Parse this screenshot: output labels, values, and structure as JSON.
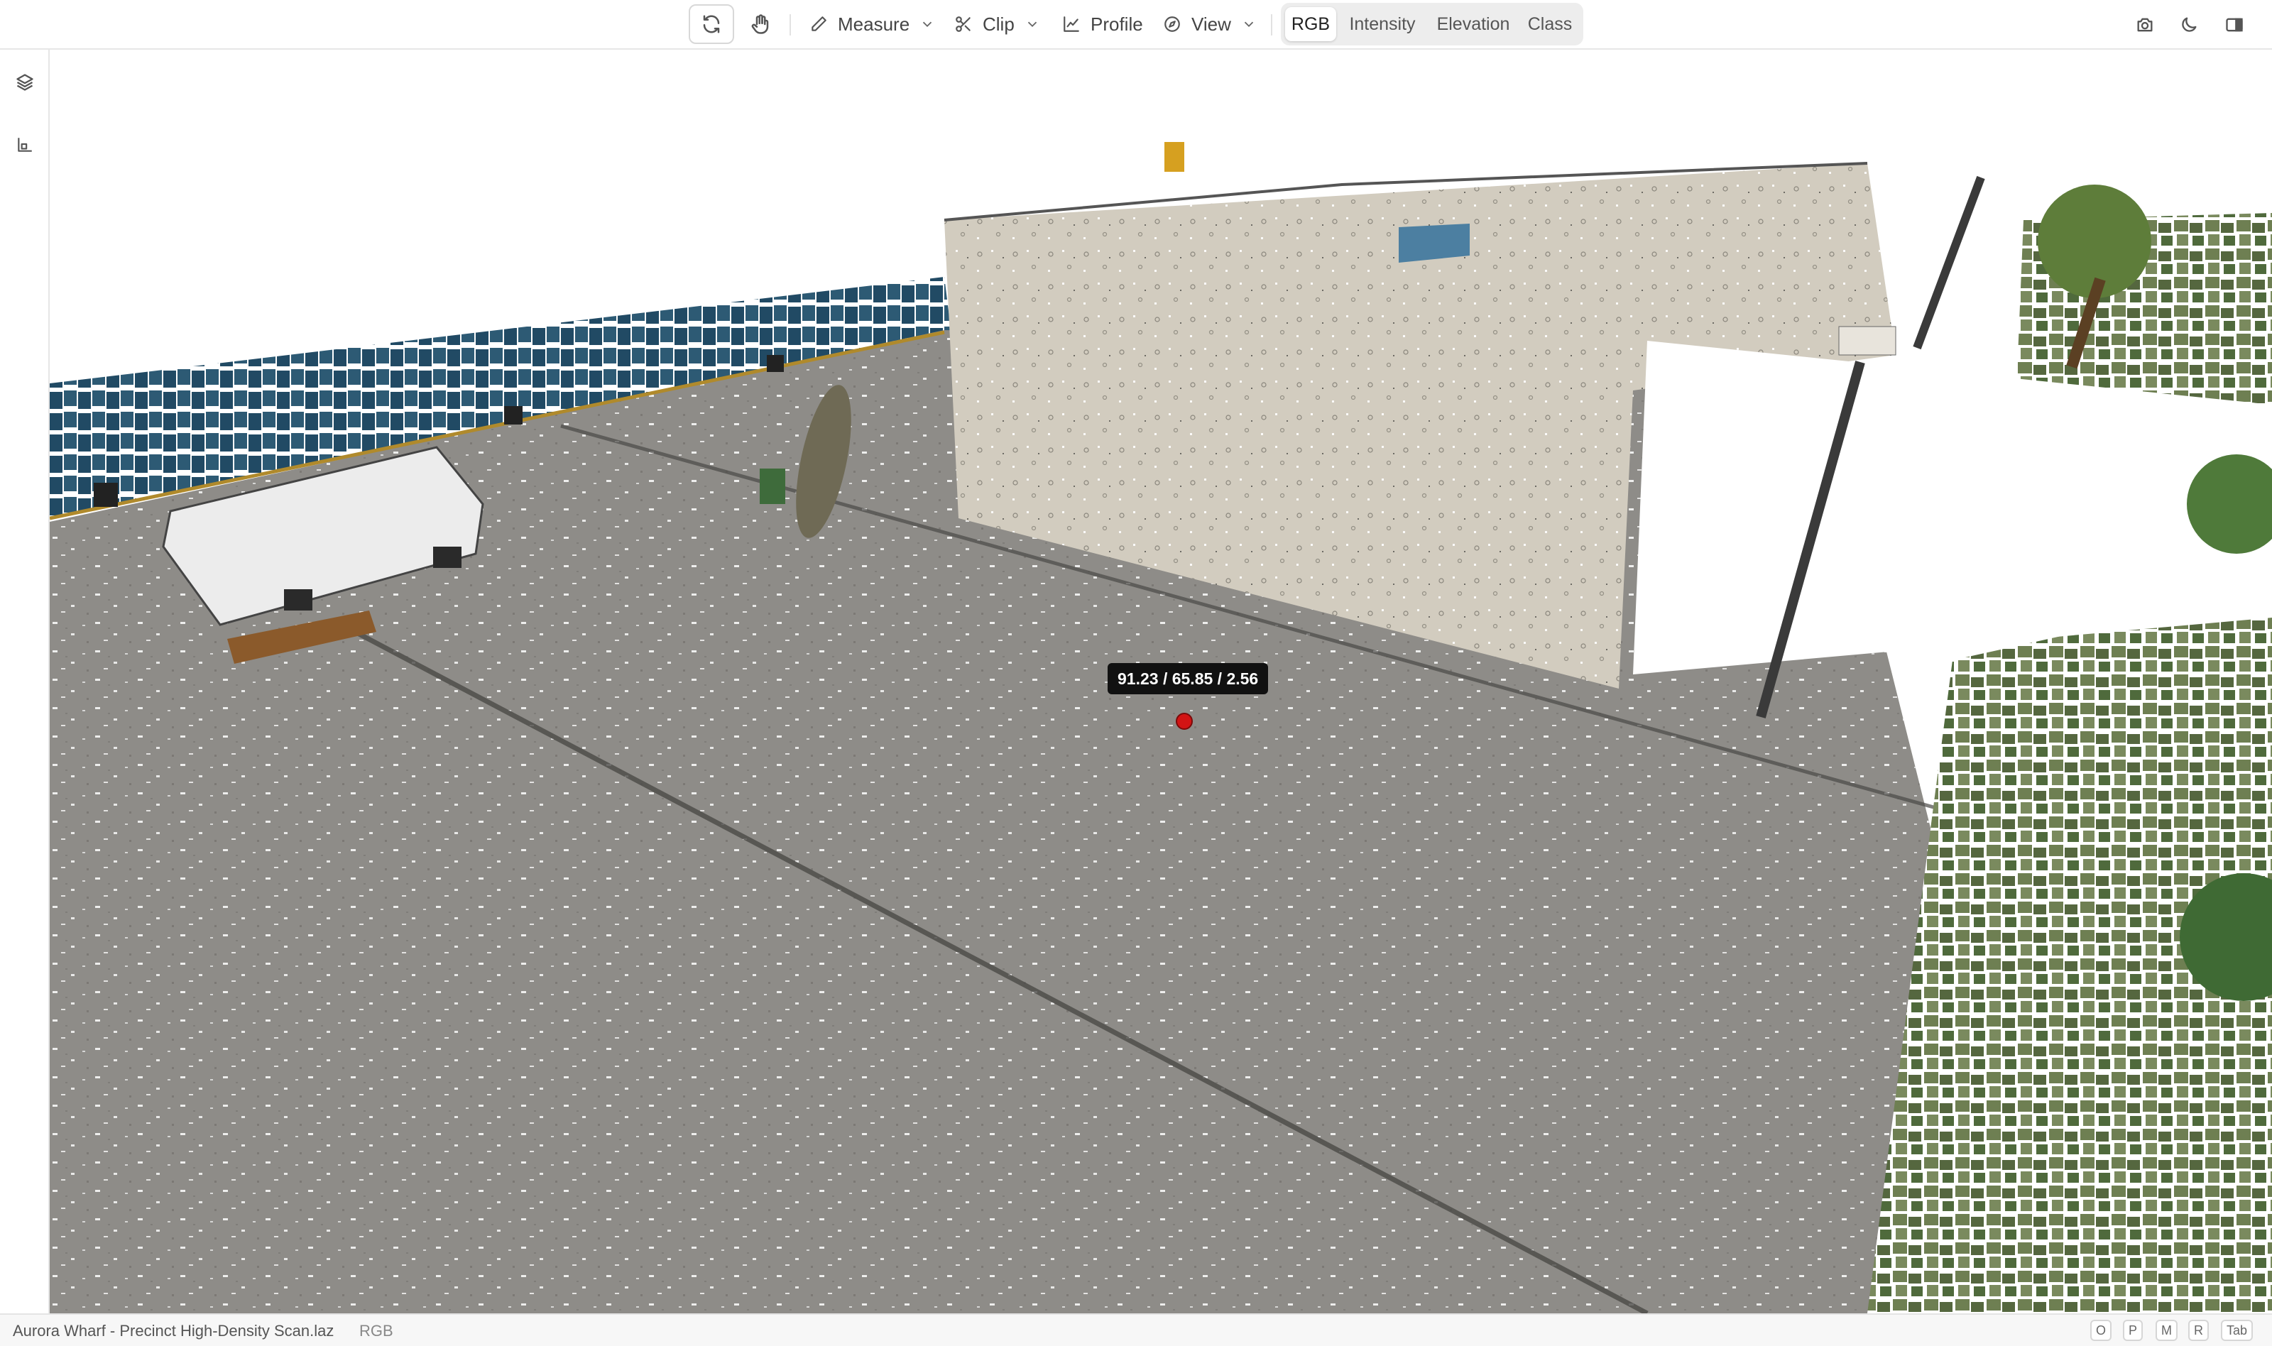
{
  "toolbar": {
    "measure_label": "Measure",
    "clip_label": "Clip",
    "profile_label": "Profile",
    "view_label": "View",
    "color_modes": [
      "RGB",
      "Intensity",
      "Elevation",
      "Class"
    ],
    "active_color_mode": "RGB",
    "icons": {
      "orbit": "refresh-orbit-icon",
      "pan": "hand-pan-icon",
      "measure": "pencil-icon",
      "clip": "scissors-icon",
      "profile": "line-chart-icon",
      "view": "compass-icon",
      "screenshot": "camera-icon",
      "theme": "moon-icon",
      "panel": "sidebar-icon"
    }
  },
  "leftrail": {
    "icons": [
      "layers-icon",
      "axes-icon"
    ]
  },
  "viewport": {
    "pick_label": "91.23 / 65.85 / 2.56",
    "pick_color": "#d21414"
  },
  "status": {
    "filename": "Aurora Wharf - Precinct High-Density Scan.laz",
    "mode": "RGB",
    "shortcut_keys": [
      "O",
      "P",
      "M",
      "R",
      "Tab"
    ]
  },
  "colors": {
    "ground": "#8e8c88",
    "wall": "#d2ccbf",
    "vegetation": "#5f7a45",
    "water_fence": "#234a63"
  }
}
